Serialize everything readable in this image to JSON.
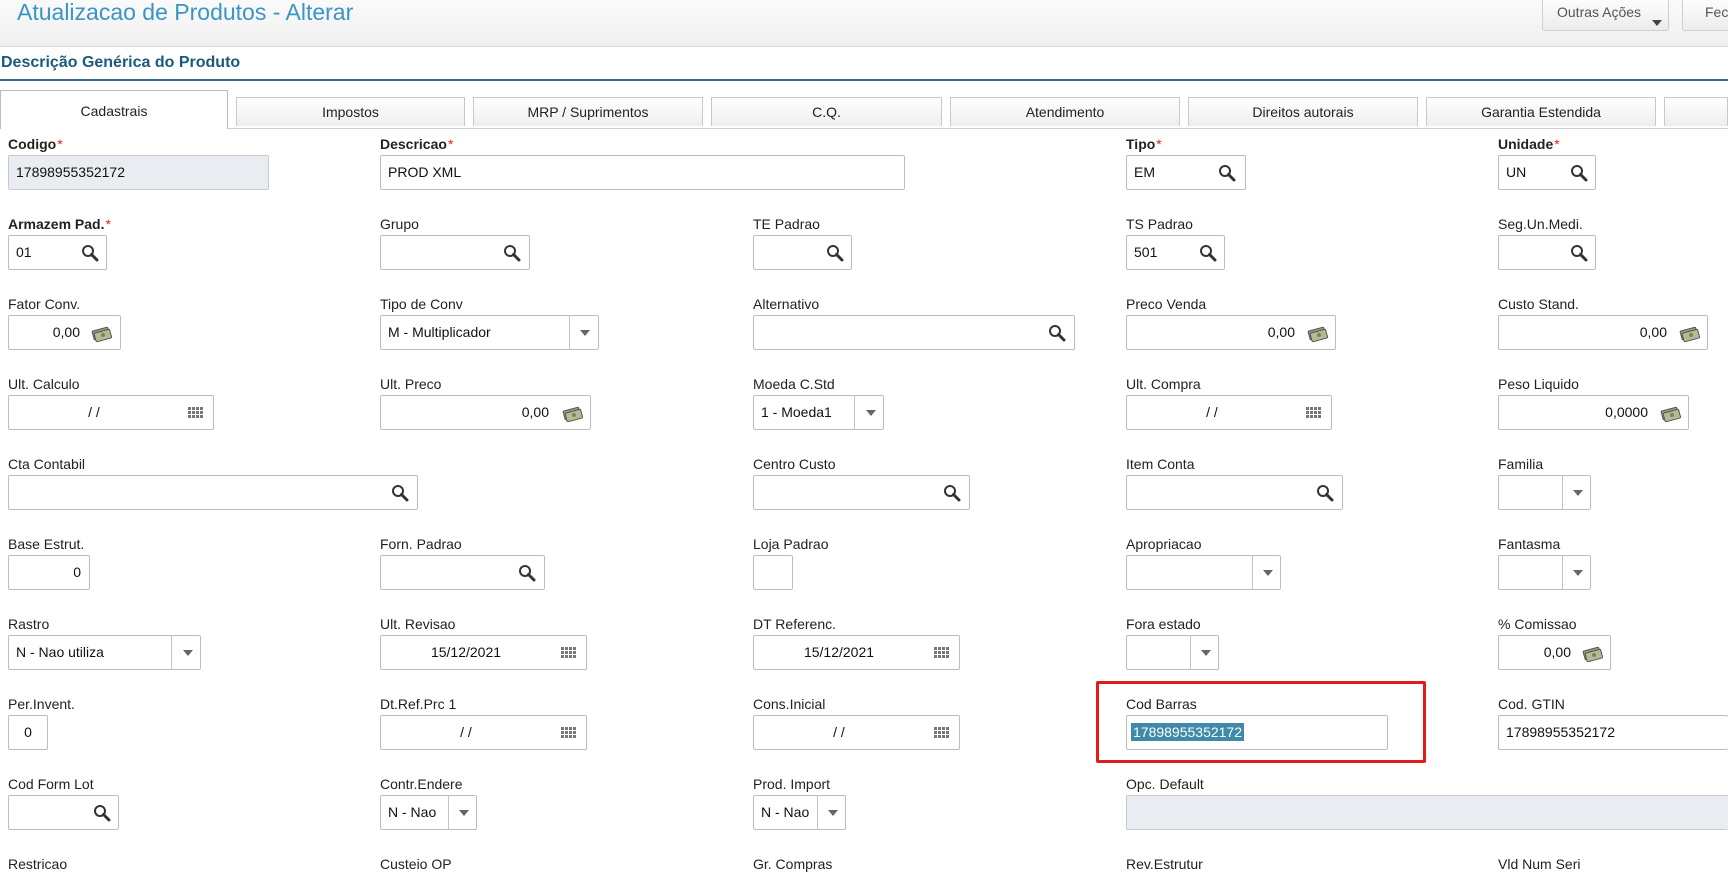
{
  "header": {
    "title": "Atualizacao de Produtos - Alterar",
    "other_actions": "Outras Ações",
    "close": "Fec"
  },
  "section_title": "Descrição Genérica do Produto",
  "tabs": [
    "Cadastrais",
    "Impostos",
    "MRP / Suprimentos",
    "C.Q.",
    "Atendimento",
    "Direitos autorais",
    "Garantia Estendida"
  ],
  "fields": {
    "codigo": {
      "label": "Codigo",
      "value": "17898955352172"
    },
    "descricao": {
      "label": "Descricao",
      "value": "PROD XML"
    },
    "tipo": {
      "label": "Tipo",
      "value": "EM"
    },
    "unidade": {
      "label": "Unidade",
      "value": "UN"
    },
    "armazem": {
      "label": "Armazem Pad.",
      "value": "01"
    },
    "grupo": {
      "label": "Grupo",
      "value": ""
    },
    "te_padrao": {
      "label": "TE Padrao",
      "value": ""
    },
    "ts_padrao": {
      "label": "TS Padrao",
      "value": "501"
    },
    "seg_un": {
      "label": "Seg.Un.Medi.",
      "value": ""
    },
    "fator_conv": {
      "label": "Fator Conv.",
      "value": "0,00"
    },
    "tipo_conv": {
      "label": "Tipo de Conv",
      "value": "M - Multiplicador"
    },
    "alternativo": {
      "label": "Alternativo",
      "value": ""
    },
    "preco_venda": {
      "label": "Preco Venda",
      "value": "0,00"
    },
    "custo_stand": {
      "label": "Custo Stand.",
      "value": "0,00"
    },
    "ult_calculo": {
      "label": "Ult. Calculo",
      "value": "/ /"
    },
    "ult_preco": {
      "label": "Ult. Preco",
      "value": "0,00"
    },
    "moeda_cstd": {
      "label": "Moeda C.Std",
      "value": "1 - Moeda1"
    },
    "ult_compra": {
      "label": "Ult. Compra",
      "value": "/ /"
    },
    "peso_liquido": {
      "label": "Peso Liquido",
      "value": "0,0000"
    },
    "cta_contabil": {
      "label": "Cta Contabil",
      "value": ""
    },
    "centro_custo": {
      "label": "Centro Custo",
      "value": ""
    },
    "item_conta": {
      "label": "Item Conta",
      "value": ""
    },
    "familia": {
      "label": "Familia",
      "value": ""
    },
    "base_estrut": {
      "label": "Base Estrut.",
      "value": "0"
    },
    "forn_padrao": {
      "label": "Forn. Padrao",
      "value": ""
    },
    "loja_padrao": {
      "label": "Loja Padrao",
      "value": ""
    },
    "apropriacao": {
      "label": "Apropriacao",
      "value": ""
    },
    "fantasma": {
      "label": "Fantasma",
      "value": ""
    },
    "rastro": {
      "label": "Rastro",
      "value": "N - Nao utiliza"
    },
    "ult_revisao": {
      "label": "Ult. Revisao",
      "value": "15/12/2021"
    },
    "dt_referenc": {
      "label": "DT Referenc.",
      "value": "15/12/2021"
    },
    "fora_estado": {
      "label": "Fora estado",
      "value": ""
    },
    "comissao": {
      "label": "% Comissao",
      "value": "0,00"
    },
    "per_invent": {
      "label": "Per.Invent.",
      "value": "0"
    },
    "dt_ref_prc": {
      "label": "Dt.Ref.Prc 1",
      "value": "/ /"
    },
    "cons_inicial": {
      "label": "Cons.Inicial",
      "value": "/ /"
    },
    "cod_barras": {
      "label": "Cod Barras",
      "value": "17898955352172"
    },
    "cod_gtin": {
      "label": "Cod. GTIN",
      "value": "17898955352172"
    },
    "cod_form_lot": {
      "label": "Cod Form Lot",
      "value": ""
    },
    "contr_endere": {
      "label": "Contr.Endere",
      "value": "N - Nao"
    },
    "prod_import": {
      "label": "Prod. Import",
      "value": "N - Nao"
    },
    "opc_default": {
      "label": "Opc. Default",
      "value": ""
    },
    "restricao": {
      "label": "Restricao"
    },
    "custeio_op": {
      "label": "Custeio OP"
    },
    "gr_compras": {
      "label": "Gr. Compras"
    },
    "rev_estrutur": {
      "label": "Rev.Estrutur"
    },
    "vld_num_seri": {
      "label": "Vld Num Seri"
    }
  },
  "colors": {
    "accent": "#3a95c4",
    "section": "#1a5a7c",
    "highlight_box": "#e31b1b"
  }
}
